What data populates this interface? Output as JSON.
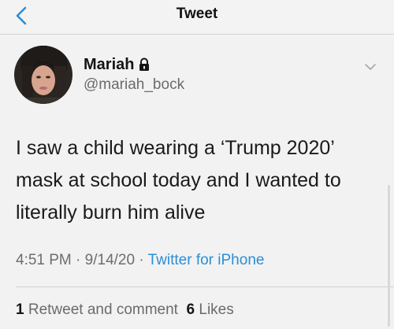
{
  "header": {
    "title": "Tweet",
    "back_icon": "chevron-left-icon"
  },
  "author": {
    "name": "Mariah",
    "handle": "@mariah_bock",
    "protected_icon": "lock-icon",
    "more_icon": "chevron-down-icon"
  },
  "tweet": {
    "text": "I saw a child wearing a ‘Trump 2020’ mask at school today and I wanted to literally burn him alive",
    "time": "4:51 PM",
    "date": "9/14/20",
    "separator": "·",
    "source": "Twitter for iPhone"
  },
  "stats": {
    "retweets_count": "1",
    "retweets_label": "Retweet and comment",
    "likes_count": "6",
    "likes_label": "Likes"
  },
  "colors": {
    "accent": "#2a8fd6",
    "text": "#1a1a1a",
    "secondary": "#6b6b6b",
    "background": "#f2f2f2"
  }
}
